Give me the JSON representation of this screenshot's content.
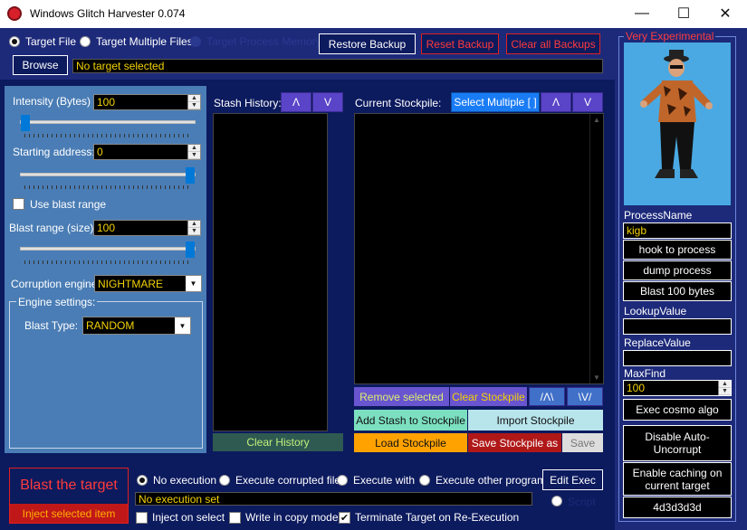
{
  "window": {
    "title": "Windows Glitch Harvester 0.074",
    "minimize": "—",
    "maximize": "☐",
    "close": "✕"
  },
  "target": {
    "mode_options": [
      "Target File",
      "Target Multiple Files",
      "Target Process Memory"
    ],
    "selected_mode": "Target File",
    "browse_label": "Browse",
    "status": "No target selected"
  },
  "backups": {
    "restore": "Restore Backup",
    "reset": "Reset Backup",
    "clear_all": "Clear all Backups"
  },
  "intensity": {
    "label": "Intensity (Bytes) :",
    "value": "100",
    "slider_position": 0.03
  },
  "starting_address": {
    "label": "Starting address:",
    "value": "0",
    "slider_position": 1.0
  },
  "blast_range": {
    "use_label": "Use blast range",
    "use_checked": false,
    "size_label": "Blast range (size) :",
    "size_value": "100",
    "slider_position": 1.0
  },
  "engine": {
    "label": "Corruption engine:",
    "value": "NIGHTMARE",
    "settings_label": "Engine settings:",
    "blast_type_label": "Blast Type:",
    "blast_type_value": "RANDOM"
  },
  "stash": {
    "title": "Stash History:",
    "up": "Λ",
    "down": "V",
    "clear_label": "Clear History"
  },
  "stockpile": {
    "title": "Current Stockpile:",
    "select_multiple": "Select Multiple [ ]",
    "up": "Λ",
    "down": "V",
    "remove_selected": "Remove selected",
    "clear_stockpile": "Clear Stockpile",
    "move_up": "/Λ\\",
    "move_down": "\\V/",
    "add_stash": "Add Stash to Stockpile",
    "import": "Import Stockpile",
    "load": "Load Stockpile",
    "save_as": "Save Stockpile as",
    "save": "Save"
  },
  "blast": {
    "title": "Blast the target",
    "inject": "Inject selected item"
  },
  "execution": {
    "options": [
      "No execution",
      "Execute corrupted file",
      "Execute with",
      "Execute other program"
    ],
    "selected": "No execution",
    "edit_exec": "Edit Exec",
    "script_label": "Script",
    "status": "No execution set",
    "inject_on_select": "Inject on select",
    "inject_on_select_checked": false,
    "write_copy_mode": "Write in copy mode",
    "write_copy_mode_checked": false,
    "terminate_reexec": "Terminate Target on Re-Execution",
    "terminate_reexec_checked": true
  },
  "experimental": {
    "title": "Very Experimental",
    "process_name_label": "ProcessName",
    "process_name_value": "kigb",
    "hook": "hook to process",
    "dump": "dump process",
    "blast_bytes": "Blast 100 bytes",
    "lookup_label": "LookupValue",
    "lookup_value": "",
    "replace_label": "ReplaceValue",
    "replace_value": "",
    "maxfind_label": "MaxFind",
    "maxfind_value": "100",
    "exec_cosmo": "Exec cosmo algo",
    "disable_uncorrupt": "Disable Auto-Uncorrupt",
    "enable_caching": "Enable caching on current target",
    "hex_value": "4d3d3d3d"
  },
  "colors": {
    "navy": "#0c1a5e",
    "panel_blue": "#4a7db5",
    "field_yellow": "#f2d200",
    "danger_red": "#e02020"
  }
}
